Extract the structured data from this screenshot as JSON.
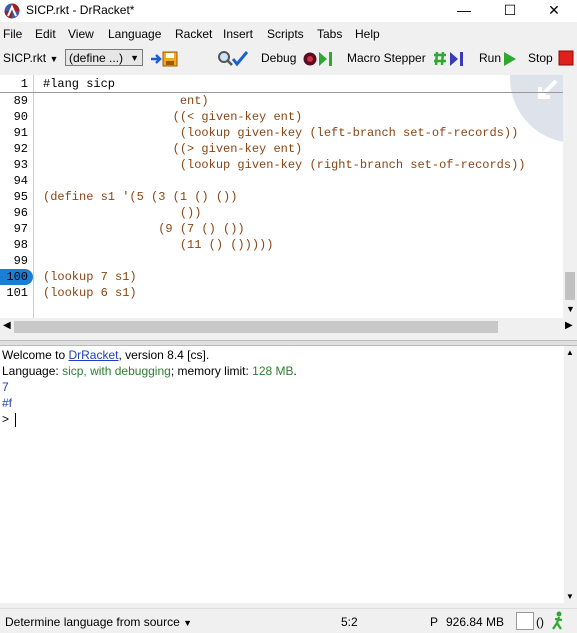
{
  "window": {
    "title": "SICP.rkt - DrRacket*",
    "minimize": "—",
    "maximize": "☐",
    "close": "✕"
  },
  "menu": [
    "File",
    "Edit",
    "View",
    "Language",
    "Racket",
    "Insert",
    "Scripts",
    "Tabs",
    "Help"
  ],
  "toolbar": {
    "file_label": "SICP.rkt",
    "define_label": "(define ...)",
    "debug": "Debug",
    "macro_stepper": "Macro Stepper",
    "run": "Run",
    "stop": "Stop"
  },
  "editor": {
    "first_line_number": "1",
    "first_line_code": "#lang sicp",
    "lines": [
      {
        "n": "89",
        "code": "                   ent)"
      },
      {
        "n": "90",
        "code": "                  ((< given-key ent)"
      },
      {
        "n": "91",
        "code": "                   (lookup given-key (left-branch set-of-records))"
      },
      {
        "n": "92",
        "code": "                  ((> given-key ent)"
      },
      {
        "n": "93",
        "code": "                   (lookup given-key (right-branch set-of-records))"
      },
      {
        "n": "94",
        "code": ""
      },
      {
        "n": "95",
        "code": "(define s1 '(5 (3 (1 () ())"
      },
      {
        "n": "96",
        "code": "                   ())"
      },
      {
        "n": "97",
        "code": "                (9 (7 () ())"
      },
      {
        "n": "98",
        "code": "                   (11 () ()))))"
      },
      {
        "n": "99",
        "code": ""
      },
      {
        "n": "100",
        "code": "(lookup 7 s1)"
      },
      {
        "n": "101",
        "code": "(lookup 6 s1)"
      }
    ],
    "highlighted_line": "100"
  },
  "repl": {
    "welcome_prefix": "Welcome to ",
    "welcome_link": "DrRacket",
    "welcome_suffix": ", version 8.4 [cs].",
    "language_prefix": "Language: ",
    "language_value": "sicp, with debugging",
    "memory_prefix": "; memory limit: ",
    "memory_value": "128 MB",
    "memory_suffix": ".",
    "output1": "7",
    "output2": "#f",
    "prompt": ">"
  },
  "status": {
    "language_selector": "Determine language from source",
    "position": "5:2",
    "mode": "P",
    "memory": "926.84 MB",
    "parens": "()"
  },
  "colors": {
    "code": "#8b4513",
    "highlight": "#1a7fd4",
    "repl_output": "#1f3fbf",
    "repl_lang": "#2e7d32"
  }
}
